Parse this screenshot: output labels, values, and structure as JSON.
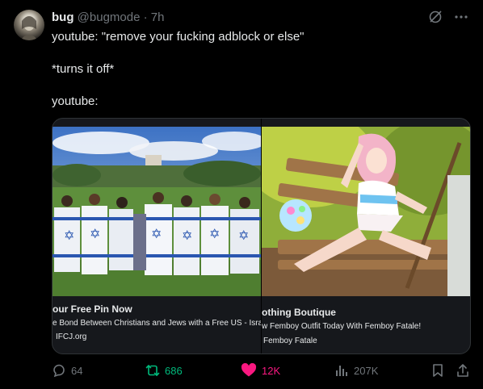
{
  "author": {
    "display_name": "bug",
    "handle": "@bugmode",
    "separator": "·",
    "time": "7h"
  },
  "tweet": {
    "line1": "youtube: \"remove your fucking adblock or else\"",
    "line2": "*turns it off*",
    "line3": "youtube:"
  },
  "cards": [
    {
      "title": "our Free Pin Now",
      "description": "e Bond Between Christians and Jews with a Free US - Isra",
      "domain": "IFCJ.org"
    },
    {
      "title": "othing Boutique",
      "description": "w Femboy Outfit Today With Femboy Fatale!",
      "domain": "Femboy Fatale"
    }
  ],
  "actions": {
    "replies": "64",
    "reposts": "686",
    "likes": "12K",
    "views": "207K"
  },
  "colors": {
    "background": "#000000",
    "text": "#e7e9ea",
    "muted": "#71767b",
    "repost_green": "#00ba7c",
    "like_pink": "#f91880"
  },
  "icons": [
    "grok-icon",
    "more-icon",
    "reply-icon",
    "repost-icon",
    "like-icon",
    "views-icon",
    "bookmark-icon",
    "share-icon"
  ]
}
